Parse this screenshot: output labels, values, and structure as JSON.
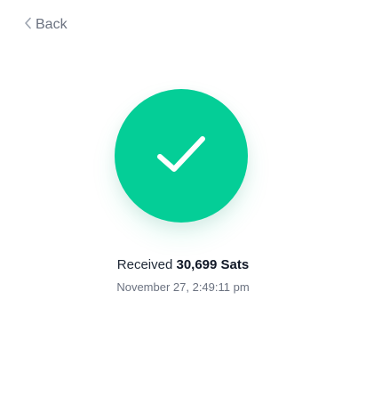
{
  "header": {
    "back_label": "Back",
    "back_icon": "chevron-left-icon"
  },
  "status": {
    "icon": "checkmark-icon",
    "accent_color": "#04ce97"
  },
  "payment": {
    "received_prefix": "Received",
    "amount_text": "30,699 Sats",
    "timestamp": "November 27, 2:49:11 pm"
  }
}
